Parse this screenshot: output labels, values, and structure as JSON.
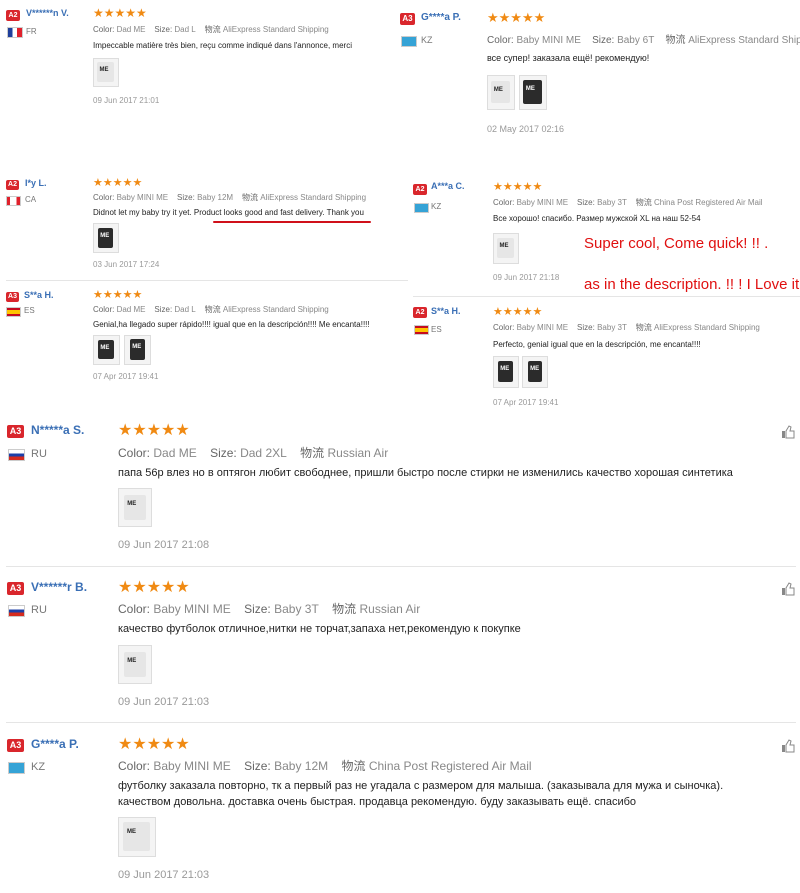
{
  "labels": {
    "color": "Color:",
    "size": "Size:",
    "ship_icon": "物流"
  },
  "star_string": "★★★★★",
  "reviews": [
    {
      "badge": "A2",
      "name": "V******n V.",
      "country": "FR",
      "flag": "fr-flag-icon",
      "color": "Dad ME",
      "size": "Dad L",
      "shipping": "AliExpress Standard Shipping",
      "text": "Impeccable matière très bien, reçu comme indiqué dans l'annonce, merci",
      "date": "09 Jun 2017 21:01"
    },
    {
      "badge": "A3",
      "name": "G****a P.",
      "country": "KZ",
      "flag": "kz-flag-icon",
      "color": "Baby MINI ME",
      "size": "Baby 6T",
      "shipping": "AliExpress Standard Shipping",
      "text": "все супер! заказала ещё! рекомендую!",
      "date": "02 May 2017 02:16"
    },
    {
      "badge": "A2",
      "name": "I*y L.",
      "country": "CA",
      "flag": "ca-flag-icon",
      "color": "Baby MINI ME",
      "size": "Baby 12M",
      "shipping": "AliExpress Standard Shipping",
      "text": "Didnot let my baby try it yet. Product looks good and fast delivery. Thank you",
      "date": "03 Jun 2017 17:24"
    },
    {
      "badge": "A2",
      "name": "A***a C.",
      "country": "KZ",
      "flag": "kz-flag-icon",
      "color": "Baby MINI ME",
      "size": "Baby 3T",
      "shipping": "China Post Registered Air Mail",
      "text": "Все хорошо! спасибо. Размер мужской XL на наш 52-54",
      "date": "09 Jun 2017 21:18"
    },
    {
      "badge": "A3",
      "name": "S**a H.",
      "country": "ES",
      "flag": "es-flag-icon",
      "color": "Dad ME",
      "size": "Dad L",
      "shipping": "AliExpress Standard Shipping",
      "text": "Genial,ha llegado super rápido!!!! igual que en la descripción!!!! Me encanta!!!!",
      "date": "07 Apr 2017 19:41"
    },
    {
      "badge": "A2",
      "name": "S**a H.",
      "country": "ES",
      "flag": "es-flag-icon",
      "color": "Baby MINI ME",
      "size": "Baby 3T",
      "shipping": "AliExpress Standard Shipping",
      "text": "Perfecto, genial igual que en la descripción, me encanta!!!!",
      "date": "07 Apr 2017 19:41"
    },
    {
      "badge": "A3",
      "name": "N*****a S.",
      "country": "RU",
      "flag": "ru-flag-icon",
      "color": "Dad ME",
      "size": "Dad 2XL",
      "shipping": "Russian Air",
      "text": "папа 56р влез но в оптягон любит свободнее, пришли быстро после стирки не изменились качество хорошая синтетика",
      "date": "09 Jun 2017 21:08"
    },
    {
      "badge": "A3",
      "name": "V******r B.",
      "country": "RU",
      "flag": "ru-flag-icon",
      "color": "Baby MINI ME",
      "size": "Baby 3T",
      "shipping": "Russian Air",
      "text": "качество футболок отличное,нитки не торчат,запаха нет,рекомендую к покупке",
      "date": "09 Jun 2017 21:03"
    },
    {
      "badge": "A3",
      "name": "G****a P.",
      "country": "KZ",
      "flag": "kz-flag-icon",
      "color": "Baby MINI ME",
      "size": "Baby 12M",
      "shipping": "China Post Registered Air Mail",
      "text": "футболку заказала повторно, тк а первый раз не угадала с размером для малыша. (заказывала для мужа и сыночка).",
      "text2": "качеством довольна. доставка очень быстрая. продавца рекомендую. буду заказывать ещё. спасибо",
      "date": "09 Jun 2017 21:03"
    }
  ],
  "annotations": {
    "line1": "Super cool, Come quick! !! .",
    "line2": "as in the description. !! ! I Love it!"
  },
  "shirt_print": "ME",
  "colors": {
    "badge": "#d9262c",
    "name": "#3a6fb5",
    "stars": "#f08a13",
    "annotation": "#e01010"
  }
}
